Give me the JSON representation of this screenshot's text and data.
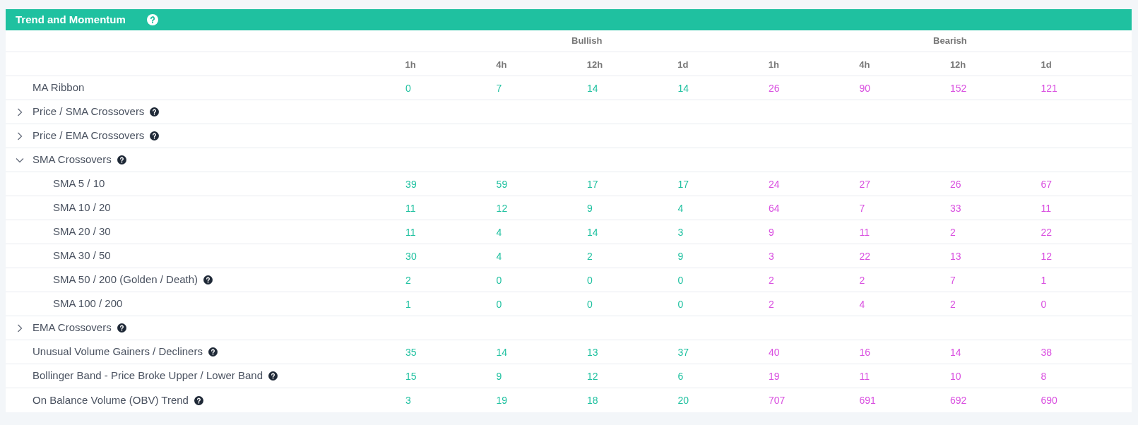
{
  "panel": {
    "title": "Trend and Momentum",
    "help": true
  },
  "column_groups": [
    {
      "label": "Bullish",
      "kind": "bullish",
      "columns": [
        "1h",
        "4h",
        "12h",
        "1d"
      ]
    },
    {
      "label": "Bearish",
      "kind": "bearish",
      "columns": [
        "1h",
        "4h",
        "12h",
        "1d"
      ]
    }
  ],
  "rows": [
    {
      "label": "MA Ribbon",
      "help": false,
      "values": [
        "0",
        "7",
        "14",
        "14",
        "26",
        "90",
        "152",
        "121"
      ]
    },
    {
      "label": "Price / SMA Crossovers",
      "help": true,
      "expanded": false
    },
    {
      "label": "Price / EMA Crossovers",
      "help": true,
      "expanded": false
    },
    {
      "label": "SMA Crossovers",
      "help": true,
      "expanded": true,
      "children": [
        {
          "label": "SMA 5 / 10",
          "help": false,
          "values": [
            "39",
            "59",
            "17",
            "17",
            "24",
            "27",
            "26",
            "67"
          ]
        },
        {
          "label": "SMA 10 / 20",
          "help": false,
          "values": [
            "11",
            "12",
            "9",
            "4",
            "64",
            "7",
            "33",
            "11"
          ]
        },
        {
          "label": "SMA 20 / 30",
          "help": false,
          "values": [
            "11",
            "4",
            "14",
            "3",
            "9",
            "11",
            "2",
            "22"
          ]
        },
        {
          "label": "SMA 30 / 50",
          "help": false,
          "values": [
            "30",
            "4",
            "2",
            "9",
            "3",
            "22",
            "13",
            "12"
          ]
        },
        {
          "label": "SMA 50 / 200 (Golden / Death)",
          "help": true,
          "values": [
            "2",
            "0",
            "0",
            "0",
            "2",
            "2",
            "7",
            "1"
          ]
        },
        {
          "label": "SMA 100 / 200",
          "help": false,
          "values": [
            "1",
            "0",
            "0",
            "0",
            "2",
            "4",
            "2",
            "0"
          ]
        }
      ]
    },
    {
      "label": "EMA Crossovers",
      "help": true,
      "expanded": false
    },
    {
      "label": "Unusual Volume Gainers / Decliners",
      "help": true,
      "values": [
        "35",
        "14",
        "13",
        "37",
        "40",
        "16",
        "14",
        "38"
      ]
    },
    {
      "label": "Bollinger Band - Price Broke Upper / Lower Band",
      "help": true,
      "values": [
        "15",
        "9",
        "12",
        "6",
        "19",
        "11",
        "10",
        "8"
      ]
    },
    {
      "label": "On Balance Volume (OBV) Trend",
      "help": true,
      "values": [
        "3",
        "19",
        "18",
        "20",
        "707",
        "691",
        "692",
        "690"
      ]
    }
  ]
}
